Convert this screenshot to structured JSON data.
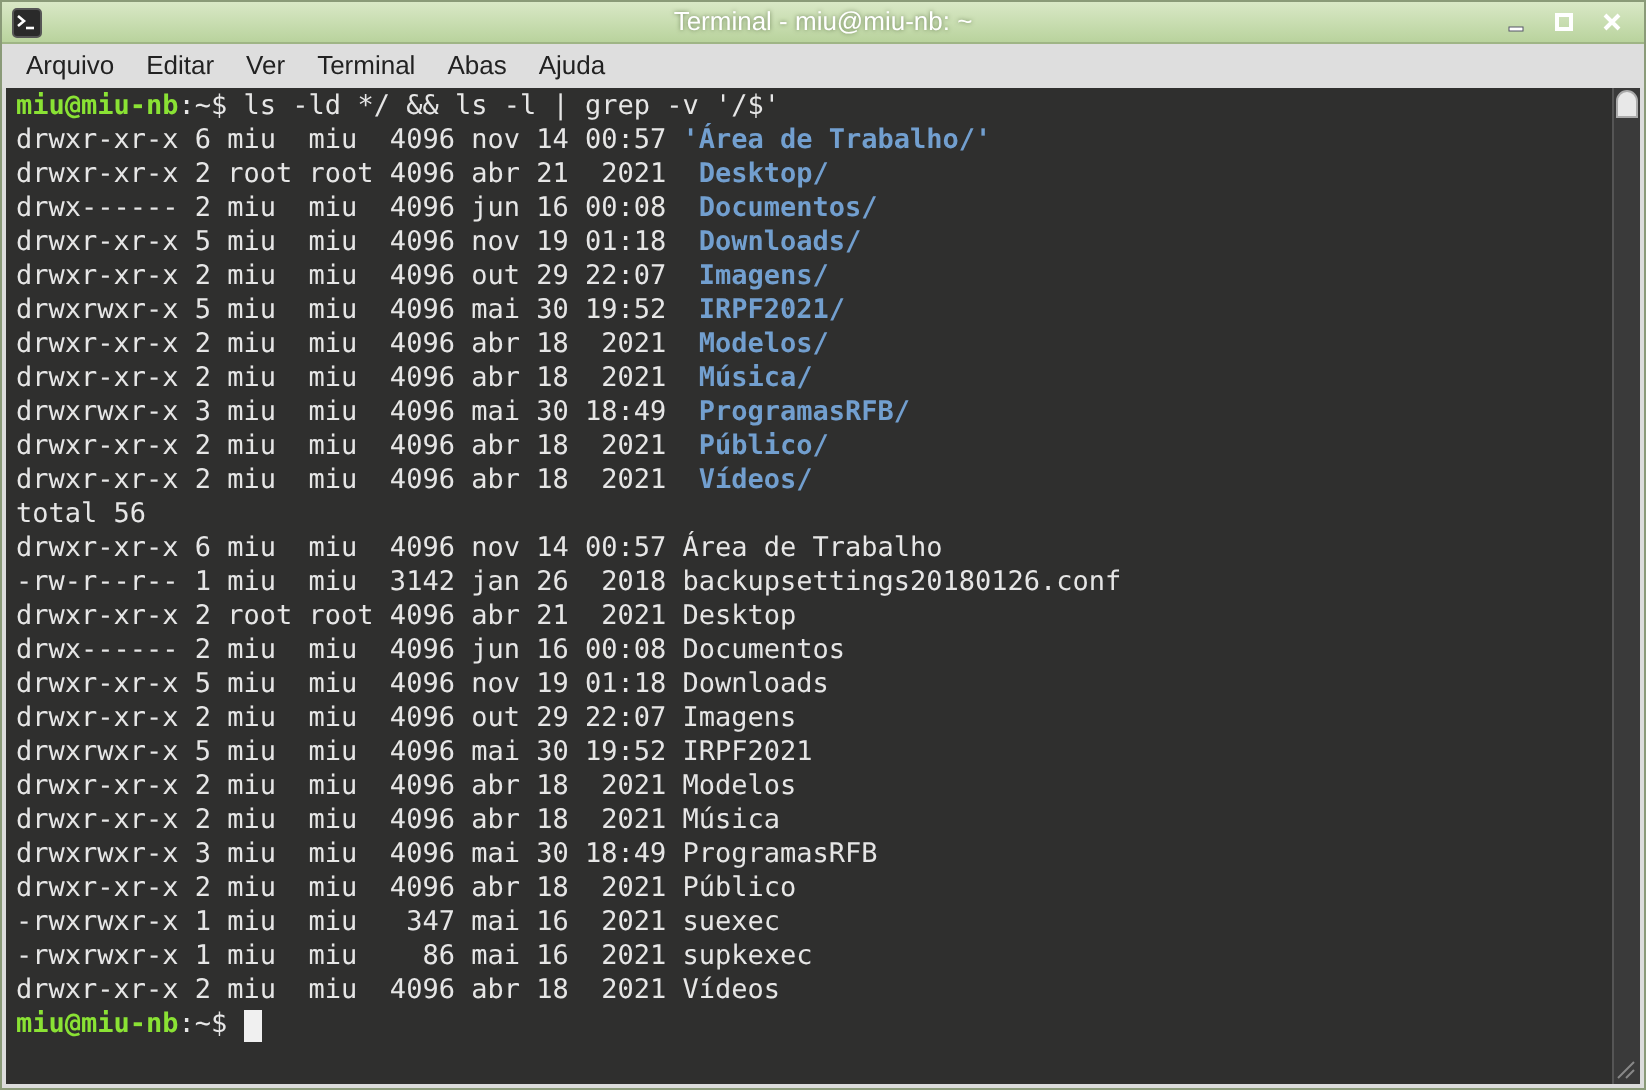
{
  "window": {
    "title": "Terminal - miu@miu-nb: ~"
  },
  "menu": [
    "Arquivo",
    "Editar",
    "Ver",
    "Terminal",
    "Abas",
    "Ajuda"
  ],
  "lines": [
    {
      "kind": "prompt",
      "user": "miu@miu-nb",
      "path": ":~$",
      "command": "ls -ld */ && ls -l | grep -v '/$'"
    },
    {
      "kind": "dir",
      "meta": "drwxr-xr-x 6 miu  miu  4096 nov 14 00:57",
      "name": "'Área de Trabalho/'"
    },
    {
      "kind": "dir",
      "meta": "drwxr-xr-x 2 root root 4096 abr 21  2021",
      "name": " Desktop/"
    },
    {
      "kind": "dir",
      "meta": "drwx------ 2 miu  miu  4096 jun 16 00:08",
      "name": " Documentos/"
    },
    {
      "kind": "dir",
      "meta": "drwxr-xr-x 5 miu  miu  4096 nov 19 01:18",
      "name": " Downloads/"
    },
    {
      "kind": "dir",
      "meta": "drwxr-xr-x 2 miu  miu  4096 out 29 22:07",
      "name": " Imagens/"
    },
    {
      "kind": "dir",
      "meta": "drwxrwxr-x 5 miu  miu  4096 mai 30 19:52",
      "name": " IRPF2021/"
    },
    {
      "kind": "dir",
      "meta": "drwxr-xr-x 2 miu  miu  4096 abr 18  2021",
      "name": " Modelos/"
    },
    {
      "kind": "dir",
      "meta": "drwxr-xr-x 2 miu  miu  4096 abr 18  2021",
      "name": " Música/"
    },
    {
      "kind": "dir",
      "meta": "drwxrwxr-x 3 miu  miu  4096 mai 30 18:49",
      "name": " ProgramasRFB/"
    },
    {
      "kind": "dir",
      "meta": "drwxr-xr-x 2 miu  miu  4096 abr 18  2021",
      "name": " Público/"
    },
    {
      "kind": "dir",
      "meta": "drwxr-xr-x 2 miu  miu  4096 abr 18  2021",
      "name": " Vídeos/"
    },
    {
      "kind": "text",
      "text": "total 56"
    },
    {
      "kind": "text",
      "text": "drwxr-xr-x 6 miu  miu  4096 nov 14 00:57 Área de Trabalho"
    },
    {
      "kind": "text",
      "text": "-rw-r--r-- 1 miu  miu  3142 jan 26  2018 backupsettings20180126.conf"
    },
    {
      "kind": "text",
      "text": "drwxr-xr-x 2 root root 4096 abr 21  2021 Desktop"
    },
    {
      "kind": "text",
      "text": "drwx------ 2 miu  miu  4096 jun 16 00:08 Documentos"
    },
    {
      "kind": "text",
      "text": "drwxr-xr-x 5 miu  miu  4096 nov 19 01:18 Downloads"
    },
    {
      "kind": "text",
      "text": "drwxr-xr-x 2 miu  miu  4096 out 29 22:07 Imagens"
    },
    {
      "kind": "text",
      "text": "drwxrwxr-x 5 miu  miu  4096 mai 30 19:52 IRPF2021"
    },
    {
      "kind": "text",
      "text": "drwxr-xr-x 2 miu  miu  4096 abr 18  2021 Modelos"
    },
    {
      "kind": "text",
      "text": "drwxr-xr-x 2 miu  miu  4096 abr 18  2021 Música"
    },
    {
      "kind": "text",
      "text": "drwxrwxr-x 3 miu  miu  4096 mai 30 18:49 ProgramasRFB"
    },
    {
      "kind": "text",
      "text": "drwxr-xr-x 2 miu  miu  4096 abr 18  2021 Público"
    },
    {
      "kind": "text",
      "text": "-rwxrwxr-x 1 miu  miu   347 mai 16  2021 suexec"
    },
    {
      "kind": "text",
      "text": "-rwxrwxr-x 1 miu  miu    86 mai 16  2021 supkexec"
    },
    {
      "kind": "text",
      "text": "drwxr-xr-x 2 miu  miu  4096 abr 18  2021 Vídeos"
    },
    {
      "kind": "prompt",
      "user": "miu@miu-nb",
      "path": ":~$",
      "cursor": true
    }
  ]
}
